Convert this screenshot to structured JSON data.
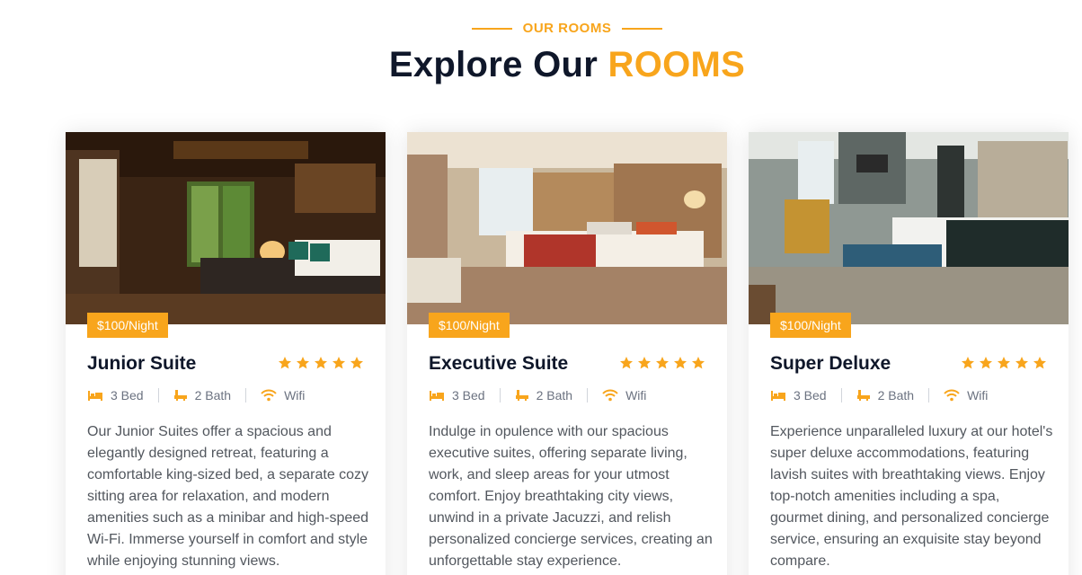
{
  "section": {
    "eyebrow": "OUR ROOMS",
    "title_main": "Explore Our",
    "title_accent": "ROOMS"
  },
  "colors": {
    "accent": "#f8a51c",
    "heading": "#0f172a",
    "body_text": "#52575e"
  },
  "rooms": [
    {
      "price": "$100/Night",
      "name": "Junior Suite",
      "rating": 5,
      "bed": "3 Bed",
      "bath": "2 Bath",
      "wifi": "Wifi",
      "description": "Our Junior Suites offer a spacious and elegantly designed retreat, featuring a comfortable king-sized bed, a separate cozy sitting area for relaxation, and modern amenities such as a minibar and high-speed Wi-Fi. Immerse yourself in comfort and style while enjoying stunning views."
    },
    {
      "price": "$100/Night",
      "name": "Executive Suite",
      "rating": 5,
      "bed": "3 Bed",
      "bath": "2 Bath",
      "wifi": "Wifi",
      "description": "Indulge in opulence with our spacious executive suites, offering separate living, work, and sleep areas for your utmost comfort. Enjoy breathtaking city views, unwind in a private Jacuzzi, and relish personalized concierge services, creating an unforgettable stay experience."
    },
    {
      "price": "$100/Night",
      "name": "Super Deluxe",
      "rating": 5,
      "bed": "3 Bed",
      "bath": "2 Bath",
      "wifi": "Wifi",
      "description": "Experience unparalleled luxury at our hotel's super deluxe accommodations, featuring lavish suites with breathtaking views. Enjoy top-notch amenities including a spa, gourmet dining, and personalized concierge service, ensuring an exquisite stay beyond compare."
    }
  ]
}
